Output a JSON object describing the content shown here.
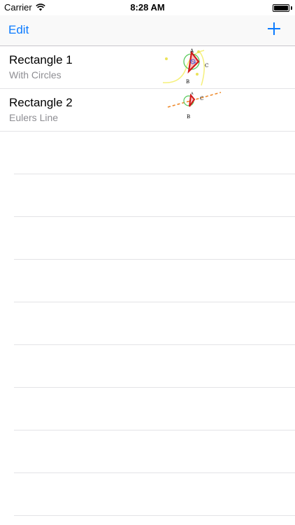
{
  "status": {
    "carrier": "Carrier",
    "time": "8:28 AM"
  },
  "nav": {
    "edit_label": "Edit",
    "add_icon": "plus-icon",
    "accent_color": "#0a7aff"
  },
  "list": {
    "items": [
      {
        "title": "Rectangle 1",
        "subtitle": "With Circles",
        "thumb_labels": [
          "A",
          "B",
          "C"
        ]
      },
      {
        "title": "Rectangle 2",
        "subtitle": "Eulers Line",
        "thumb_labels": [
          "A",
          "B",
          "C"
        ]
      }
    ]
  }
}
